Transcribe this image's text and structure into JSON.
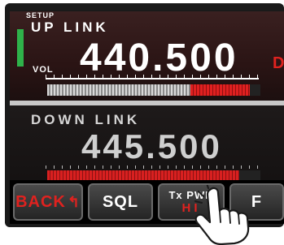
{
  "header": {
    "setup_tag": "SETUP"
  },
  "uplink": {
    "label": "UP LINK",
    "frequency": "440.500",
    "vol_label": "VOL",
    "side_tag": "DI",
    "volume_level": 0.67
  },
  "downlink": {
    "label": "DOWN LINK",
    "frequency": "445.500",
    "meter_level": 0.9
  },
  "buttons": {
    "back": "BACK",
    "back_icon": "return-arrow-icon",
    "sql": "SQL",
    "txpwr_top": "Tx PWR",
    "txpwr_bottom": "HI",
    "f": "F"
  },
  "colors": {
    "accent_red": "#e0221f",
    "indicator_green": "#2fb24a"
  }
}
